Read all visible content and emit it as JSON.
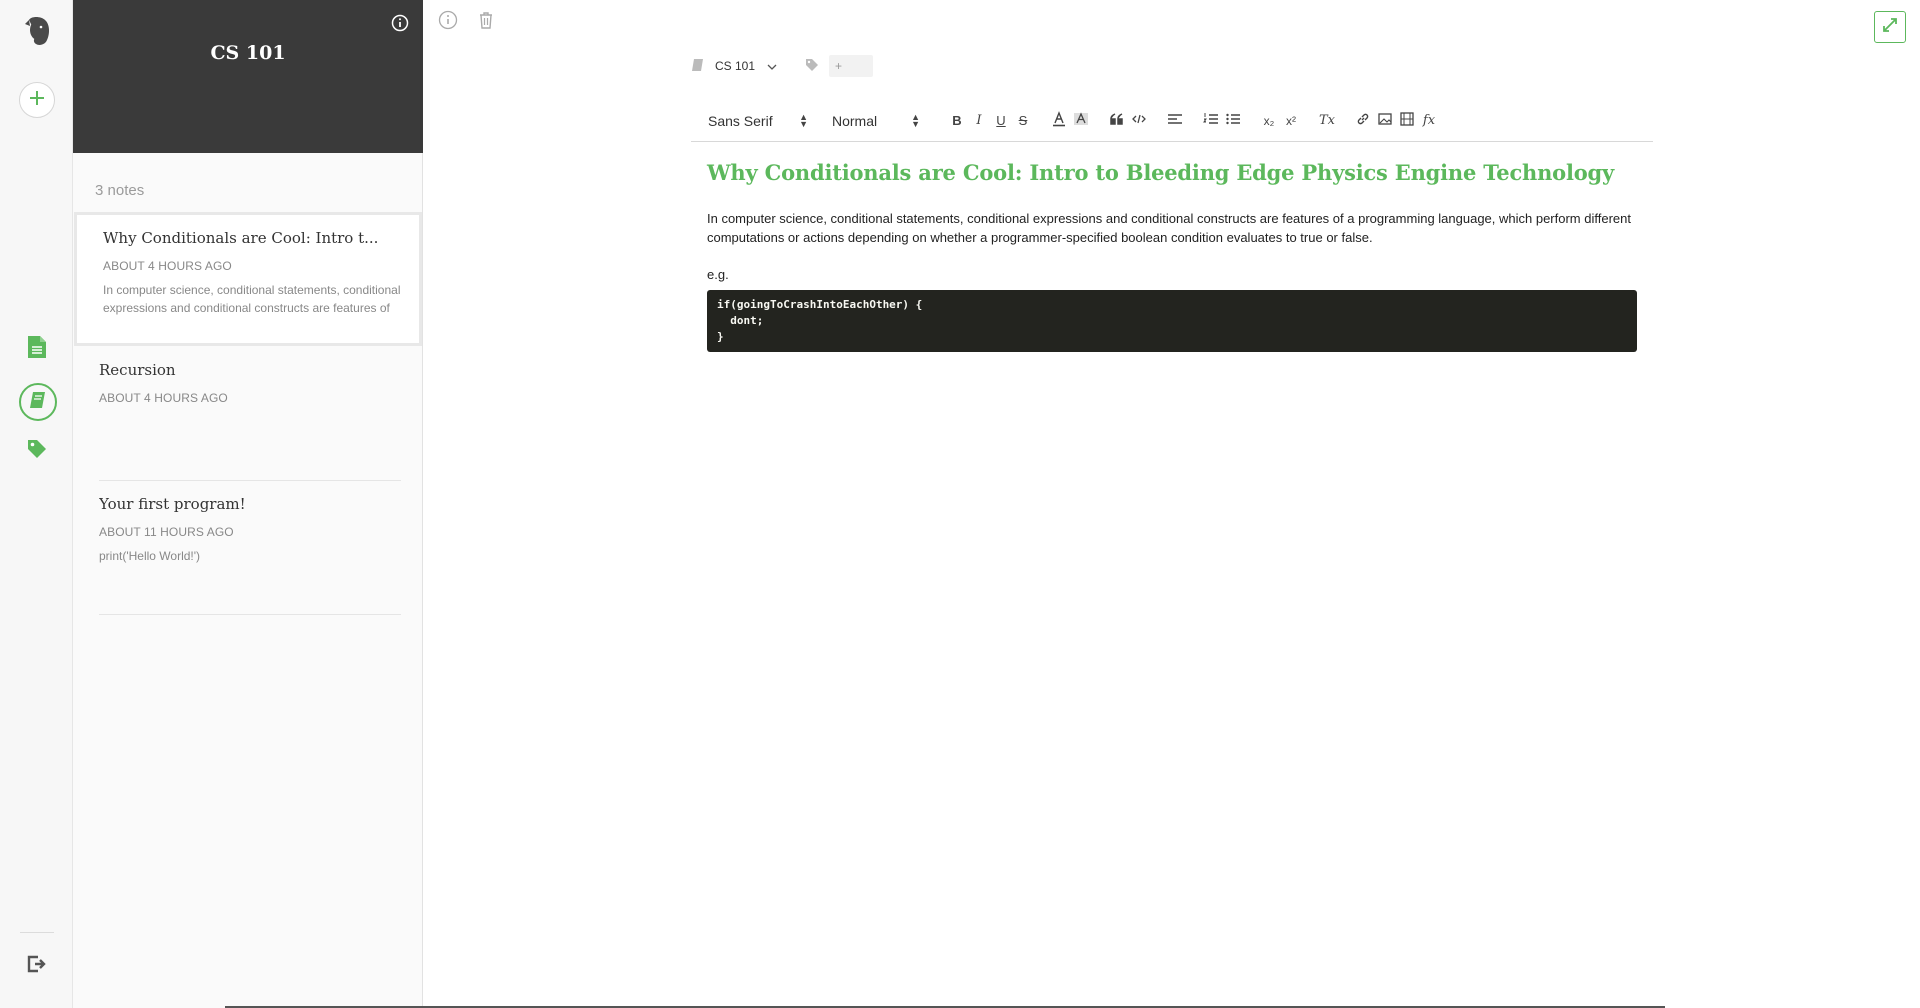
{
  "colors": {
    "accent": "#5cb85c",
    "header_bg": "#3a3a3a",
    "code_bg": "#23241f"
  },
  "rail": {
    "logo_icon": "elephant-logo-icon",
    "add_icon": "plus-icon",
    "notes_icon": "note-document-icon",
    "notebooks_icon": "notebook-icon",
    "tags_icon": "tag-icon",
    "signout_icon": "sign-out-icon"
  },
  "notebook": {
    "title": "CS 101",
    "note_count": "3 notes",
    "notes": [
      {
        "title": "Why Conditionals are Cool: Intro t...",
        "date": "ABOUT 4 HOURS AGO",
        "snippet": "In computer science, conditional statements, conditional expressions and conditional constructs are features of"
      },
      {
        "title": "Recursion",
        "date": "ABOUT 4 HOURS AGO",
        "snippet": ""
      },
      {
        "title": "Your first program!",
        "date": "ABOUT 11 HOURS AGO",
        "snippet": "print('Hello World!')"
      }
    ]
  },
  "editor": {
    "notebook_select": "CS 101",
    "tag_placeholder": "+",
    "font_family": "Sans Serif",
    "font_size": "Normal",
    "title": "Why Conditionals are Cool: Intro to Bleeding Edge Physics Engine Technology",
    "paragraph": "In computer science, conditional statements, conditional expressions and conditional constructs are features of a programming language, which perform different computations or actions depending on whether a programmer-specified boolean condition evaluates to true or false.",
    "eg": "e.g.",
    "code": "if(goingToCrashIntoEachOther) {\n  dont;\n}"
  },
  "toolbar": {
    "bold": "B",
    "italic": "I",
    "underline": "U",
    "strike": "S",
    "subscript": "x₂",
    "superscript": "x²",
    "clear": "Tx",
    "formula": "fx"
  }
}
